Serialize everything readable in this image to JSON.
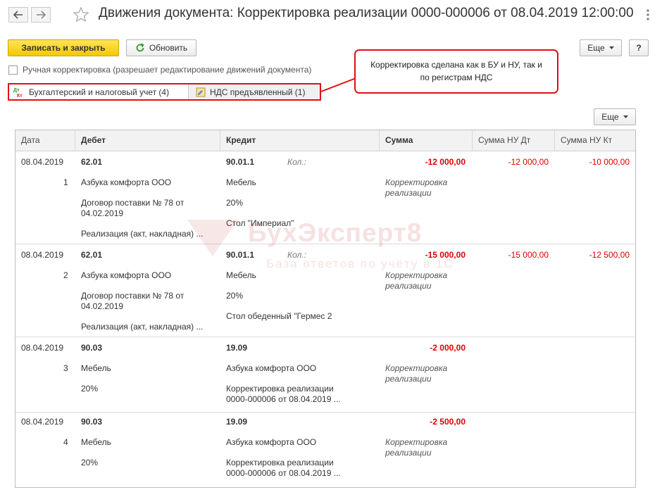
{
  "window": {
    "title": "Движения документа: Корректировка реализации 0000-000006 от 08.04.2019 12:00:00"
  },
  "toolbar": {
    "save_close_label": "Записать и закрыть",
    "refresh_label": "Обновить",
    "more_label": "Еще",
    "help_label": "?"
  },
  "manual_correction": {
    "label": "Ручная корректировка (разрешает редактирование движений документа)",
    "checked": false
  },
  "callout": {
    "line1": "Корректировка сделана как в БУ и НУ, так и",
    "line2": "по регистрам НДС"
  },
  "tabs": [
    {
      "icon": "dt-kt-icon",
      "label": "Бухгалтерский и налоговый учет (4)",
      "active": true
    },
    {
      "icon": "vat-register-icon",
      "label": "НДС предъявленный (1)",
      "active": false
    }
  ],
  "grid": {
    "more_label": "Еще",
    "columns": [
      "Дата",
      "Дебет",
      "Кредит",
      "Сумма",
      "Сумма НУ Дт",
      "Сумма НУ Кт"
    ],
    "rows": [
      {
        "date": "08.04.2019",
        "num": "1",
        "debit": "62.01",
        "debit_sub": [
          "Азбука комфорта ООО",
          "Договор поставки № 78 от\n04.02.2019",
          "Реализация (акт, накладная) ..."
        ],
        "credit": "90.01.1",
        "kol": "Кол.:",
        "credit_sub": [
          "Мебель",
          "20%",
          "Стол \"Империал\""
        ],
        "sum": "-12 000,00",
        "sum_comment": "Корректировка\nреализации",
        "nu_dt": "-12 000,00",
        "nu_kt": "-10 000,00"
      },
      {
        "date": "08.04.2019",
        "num": "2",
        "debit": "62.01",
        "debit_sub": [
          "Азбука комфорта ООО",
          "Договор поставки № 78 от\n04.02.2019",
          "Реализация (акт, накладная) ..."
        ],
        "credit": "90.01.1",
        "kol": "Кол.:",
        "credit_sub": [
          "Мебель",
          "20%",
          "Стол обеденный \"Гермес 2"
        ],
        "sum": "-15 000,00",
        "sum_comment": "Корректировка\nреализации",
        "nu_dt": "-15 000,00",
        "nu_kt": "-12 500,00"
      },
      {
        "date": "08.04.2019",
        "num": "3",
        "debit": "90.03",
        "debit_sub": [
          "Мебель",
          "20%"
        ],
        "credit": "19.09",
        "kol": "",
        "credit_sub": [
          "Азбука комфорта ООО",
          "Корректировка реализации\n0000-000006 от 08.04.2019 ..."
        ],
        "sum": "-2 000,00",
        "sum_comment": "Корректировка\nреализации",
        "nu_dt": "",
        "nu_kt": ""
      },
      {
        "date": "08.04.2019",
        "num": "4",
        "debit": "90.03",
        "debit_sub": [
          "Мебель",
          "20%"
        ],
        "credit": "19.09",
        "kol": "",
        "credit_sub": [
          "Азбука комфорта ООО",
          "Корректировка реализации\n0000-000006 от 08.04.2019 ..."
        ],
        "sum": "-2 500,00",
        "sum_comment": "Корректировка\nреализации",
        "nu_dt": "",
        "nu_kt": ""
      }
    ]
  },
  "watermark": {
    "brand": "БухЭксперт8",
    "tagline": "База ответов по учёту в 1С"
  },
  "colors": {
    "accent_yellow": "#f4c800",
    "highlight_red": "#e01010",
    "negative_amount": "#e00000"
  }
}
